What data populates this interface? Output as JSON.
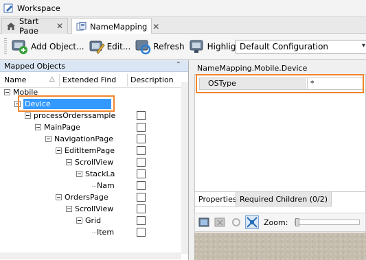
{
  "window": {
    "title": "Workspace"
  },
  "tabs": [
    {
      "label": "Start Page",
      "icon": "home-icon"
    },
    {
      "label": "NameMapping",
      "icon": "name-mapping-icon",
      "active": true
    }
  ],
  "toolbar": {
    "add_label": "Add Object...",
    "edit_label": "Edit...",
    "refresh_label": "Refresh",
    "highlight_label": "Highlight",
    "configuration_value": "Default Configuration"
  },
  "mapped_objects": {
    "panel_title": "Mapped Objects",
    "columns": {
      "name": "Name",
      "extended_find": "Extended Find",
      "description": "Description"
    },
    "tree": [
      {
        "label": "Mobile",
        "level": 0,
        "checkbox": false
      },
      {
        "label": "Device",
        "level": 1,
        "checkbox": false,
        "selected": true
      },
      {
        "label": "processOrderssample",
        "level": 2,
        "checkbox": true
      },
      {
        "label": "MainPage",
        "level": 3,
        "checkbox": true
      },
      {
        "label": "NavigationPage",
        "level": 4,
        "checkbox": true
      },
      {
        "label": "EditItemPage",
        "level": 5,
        "checkbox": true
      },
      {
        "label": "ScrollView",
        "level": 6,
        "checkbox": true
      },
      {
        "label": "StackLa",
        "level": 7,
        "checkbox": true
      },
      {
        "label": "Nam",
        "level": 8,
        "checkbox": true
      },
      {
        "label": "OrdersPage",
        "level": 5,
        "checkbox": true
      },
      {
        "label": "ScrollView",
        "level": 6,
        "checkbox": true
      },
      {
        "label": "Grid",
        "level": 7,
        "checkbox": true
      },
      {
        "label": "Item",
        "level": 8,
        "checkbox": true
      }
    ]
  },
  "properties_panel": {
    "path": "NameMapping.Mobile.Device",
    "rows": [
      {
        "name": "OSType",
        "value": "*"
      }
    ],
    "tabs": [
      {
        "label": "Properties",
        "active": true
      },
      {
        "label": "Required Children (0/2)",
        "active": false
      }
    ],
    "zoom_label": "Zoom:",
    "zoom_level": 0
  },
  "colors": {
    "highlight_outline": "#f0852d",
    "selection": "#3399ff",
    "panel_header": "#dbe6f4"
  }
}
